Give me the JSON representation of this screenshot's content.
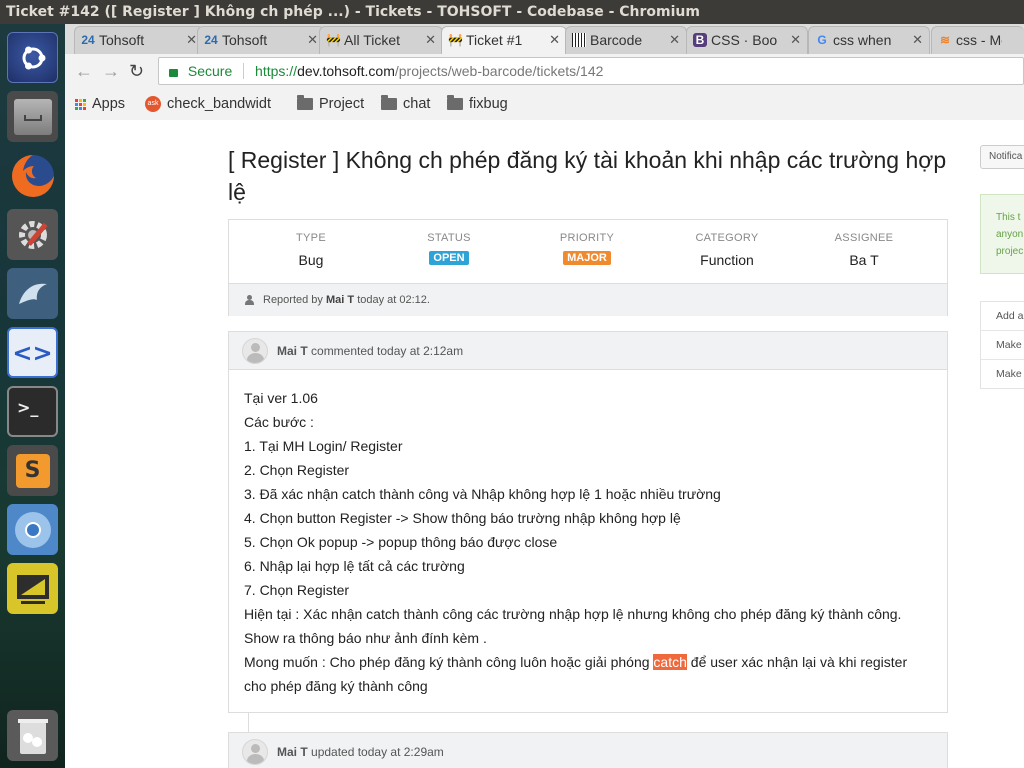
{
  "window": {
    "title": "Ticket #142 ([ Register ] Không ch phép ...) - Tickets - TOHSOFT - Codebase - Chromium"
  },
  "tabs": [
    {
      "label": "Tohsoft",
      "icon": "24-icon"
    },
    {
      "label": "Tohsoft",
      "icon": "24-icon"
    },
    {
      "label": "All Ticket",
      "icon": "codebase-icon"
    },
    {
      "label": "Ticket #1",
      "icon": "codebase-icon"
    },
    {
      "label": "Barcode",
      "icon": "barcode-icon"
    },
    {
      "label": "CSS · Boo",
      "icon": "bootstrap-icon"
    },
    {
      "label": "css when",
      "icon": "google-icon"
    },
    {
      "label": "css - Med",
      "icon": "stack-icon"
    }
  ],
  "address": {
    "secure_label": "Secure",
    "scheme": "https://",
    "host": "dev.tohsoft.com",
    "path": "/projects/web-barcode/tickets/142"
  },
  "bookmarks": {
    "apps": "Apps",
    "items": [
      "check_bandwidt",
      "Project",
      "chat",
      "fixbug"
    ]
  },
  "ticket": {
    "title": "[ Register ] Không ch phép đăng ký tài khoản khi nhập các trường hợp lệ",
    "fields": [
      {
        "label": "TYPE",
        "value": "Bug"
      },
      {
        "label": "STATUS",
        "value": "OPEN"
      },
      {
        "label": "PRIORITY",
        "value": "MAJOR"
      },
      {
        "label": "CATEGORY",
        "value": "Function"
      },
      {
        "label": "ASSIGNEE",
        "value": "Ba T"
      }
    ],
    "status_color": "#2ea3d6",
    "priority_color": "#ef8a2e",
    "reported": {
      "prefix": "Reported by",
      "user": "Mai T",
      "suffix": "today at 02:12."
    }
  },
  "comment": {
    "user": "Mai T",
    "meta": "commented today at 2:12am",
    "lines": [
      "Tại ver 1.06",
      "Các bước :",
      "1. Tại MH Login/ Register",
      "2. Chọn Register",
      "3. Đã xác nhận catch thành công và Nhập không hợp lệ 1 hoặc nhiều trường",
      "4. Chọn button Register -> Show thông báo trường nhập không hợp lệ",
      "5. Chọn Ok popup -> popup thông báo được close",
      "6. Nhập lại hợp lệ tất cả các trường",
      "7. Chọn Register",
      "Hiện tại : Xác nhận catch thành công các trường nhập hợp lệ nhưng không cho phép đăng ký thành công.",
      "Show ra thông báo như ảnh đính kèm ."
    ],
    "wish_before": "Mong muốn : Cho phép đăng ký thành công luôn hoặc giải phóng ",
    "wish_highlight": "catch",
    "wish_after": " để user xác nhận lại và khi register",
    "wish_line2": "cho phép đăng ký thành công"
  },
  "update": {
    "user": "Mai T",
    "meta": "updated today at 2:29am"
  },
  "sidebar": {
    "notifications_button": "Notifica",
    "info_lines": [
      "This t",
      "anyon",
      "projec"
    ],
    "actions": [
      "Add a",
      "Make",
      "Make"
    ]
  }
}
